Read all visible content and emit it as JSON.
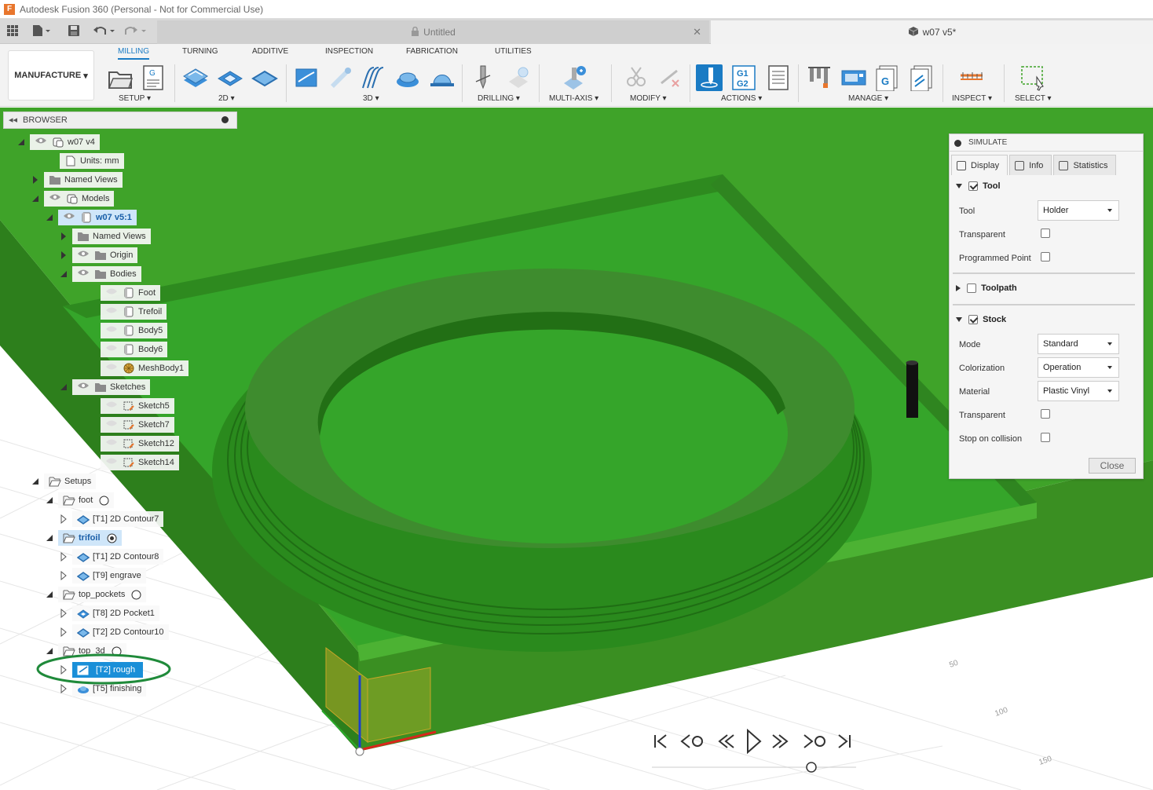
{
  "window": {
    "title": "Autodesk Fusion 360 (Personal - Not for Commercial Use)",
    "app_icon": "F"
  },
  "tabs": [
    {
      "label": "Untitled"
    },
    {
      "label": "w07 v5*"
    }
  ],
  "workspace": {
    "label": "MANUFACTURE"
  },
  "toolbar": {
    "tabs": [
      "MILLING",
      "TURNING",
      "ADDITIVE",
      "INSPECTION",
      "FABRICATION",
      "UTILITIES"
    ],
    "active_tab": "MILLING",
    "groups": [
      "SETUP",
      "2D",
      "3D",
      "DRILLING",
      "MULTI-AXIS",
      "MODIFY",
      "ACTIONS",
      "MANAGE",
      "INSPECT",
      "SELECT"
    ],
    "g_code_icon": [
      "G1",
      "G2"
    ],
    "accent": "#1a7bc4"
  },
  "browser": {
    "title": "BROWSER",
    "items": [
      {
        "label": "w07 v4",
        "icon": "component-icon",
        "eye": true
      },
      {
        "label": "Units: mm",
        "icon": "document-icon"
      },
      {
        "label": "Named Views",
        "icon": "folder-icon"
      },
      {
        "label": "Models",
        "icon": "component-icon",
        "eye": true
      },
      {
        "label": "w07 v5:1",
        "icon": "body-icon",
        "eye": true
      },
      {
        "label": "Named Views",
        "icon": "folder-icon"
      },
      {
        "label": "Origin",
        "icon": "folder-icon",
        "eye": true
      },
      {
        "label": "Bodies",
        "icon": "folder-icon",
        "eye": true
      },
      {
        "label": "Foot",
        "icon": "body-icon"
      },
      {
        "label": "Trefoil",
        "icon": "body-icon"
      },
      {
        "label": "Body5",
        "icon": "body-icon"
      },
      {
        "label": "Body6",
        "icon": "body-icon"
      },
      {
        "label": "MeshBody1",
        "icon": "mesh-icon"
      },
      {
        "label": "Sketches",
        "icon": "folder-icon",
        "eye": true
      },
      {
        "label": "Sketch5",
        "icon": "sketch-icon"
      },
      {
        "label": "Sketch7",
        "icon": "sketch-icon"
      },
      {
        "label": "Sketch12",
        "icon": "sketch-icon"
      },
      {
        "label": "Sketch14",
        "icon": "sketch-icon"
      },
      {
        "label": "Setups",
        "icon": "open-folder-icon"
      },
      {
        "label": "foot",
        "icon": "open-folder-icon"
      },
      {
        "label": "[T1] 2D Contour7",
        "icon": "contour-icon"
      },
      {
        "label": "trifoil",
        "icon": "open-folder-icon"
      },
      {
        "label": "[T1] 2D Contour8",
        "icon": "contour-icon"
      },
      {
        "label": "[T9] engrave",
        "icon": "contour-icon"
      },
      {
        "label": "top_pockets",
        "icon": "open-folder-icon"
      },
      {
        "label": "[T8] 2D Pocket1",
        "icon": "pocket-icon"
      },
      {
        "label": "[T2] 2D Contour10",
        "icon": "contour-icon"
      },
      {
        "label": "top_3d",
        "icon": "open-folder-icon"
      },
      {
        "label": "[T2] rough",
        "icon": "rough-icon"
      },
      {
        "label": "[T5] finishing",
        "icon": "finish-icon"
      }
    ]
  },
  "simulate": {
    "title": "SIMULATE",
    "tabs": [
      "Display",
      "Info",
      "Statistics"
    ],
    "tool_section": {
      "label": "Tool",
      "checked": true,
      "tool_label": "Tool",
      "tool_value": "Holder",
      "transparent_label": "Transparent",
      "transparent": false,
      "programmed_point_label": "Programmed Point",
      "programmed_point": false
    },
    "toolpath_section": {
      "label": "Toolpath",
      "checked": false
    },
    "stock_section": {
      "label": "Stock",
      "checked": true,
      "mode_label": "Mode",
      "mode_value": "Standard",
      "colorization_label": "Colorization",
      "colorization_value": "Operation",
      "material_label": "Material",
      "material_value": "Plastic Vinyl",
      "transparent_label": "Transparent",
      "transparent": false,
      "stop_label": "Stop on collision",
      "stop_on_collision": false
    },
    "close_label": "Close"
  },
  "viewport": {
    "grid_labels": [
      "50",
      "100",
      "150"
    ],
    "stock_color": "#3fa329",
    "highlight_color": "#1f8a3a"
  }
}
